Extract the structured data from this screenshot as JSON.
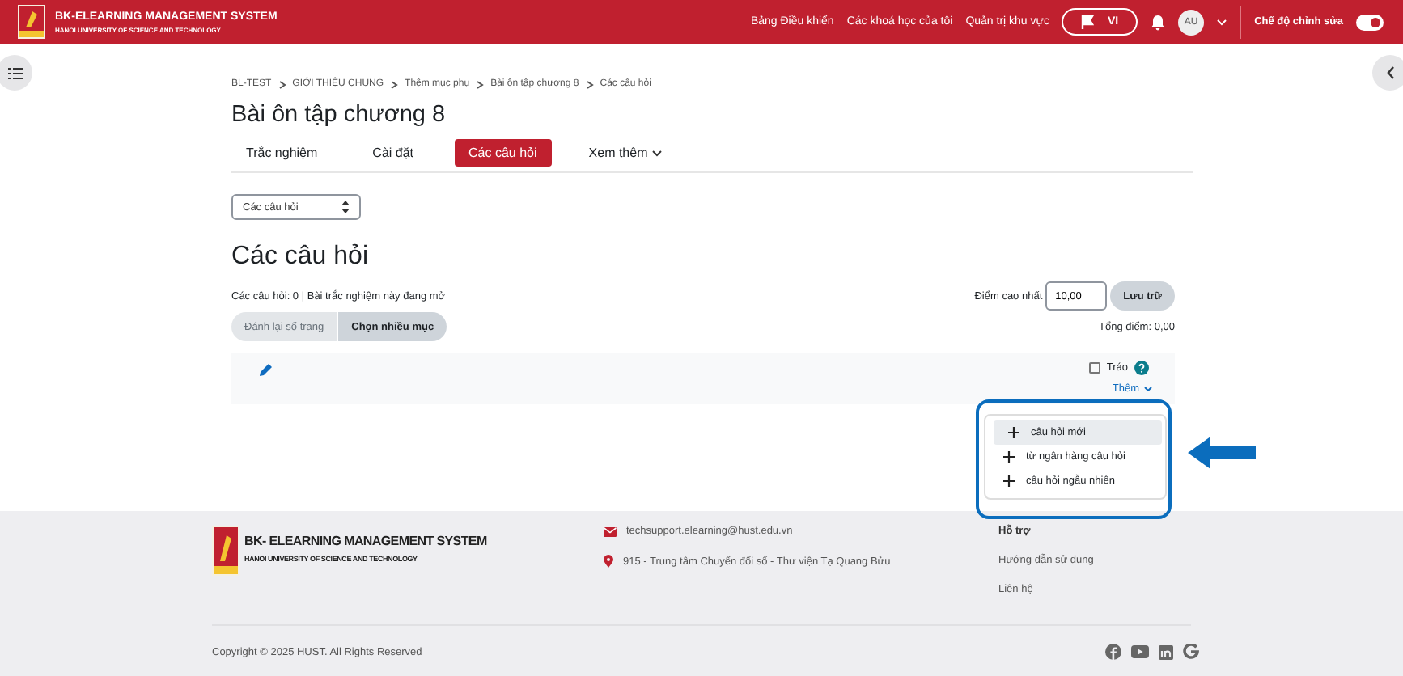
{
  "header": {
    "brand_title": "BK-ELEARNING MANAGEMENT SYSTEM",
    "brand_subtitle": "HANOI UNIVERSITY OF SCIENCE AND TECHNOLOGY",
    "nav": [
      "Bảng Điều khiển",
      "Các khoá học của tôi",
      "Quản trị khu vực"
    ],
    "language": "VI",
    "avatar": "AU",
    "edit_mode": {
      "label": "Chế độ chỉnh sửa",
      "on": true
    }
  },
  "breadcrumb": [
    "BL-TEST",
    "GIỚI THIỆU CHUNG",
    "Thêm mục phụ",
    "Bài ôn tập chương 8",
    "Các câu hỏi"
  ],
  "page_title": "Bài ôn tập chương 8",
  "tabs": [
    {
      "label": "Trắc nghiệm",
      "selected": false
    },
    {
      "label": "Cài đặt",
      "selected": false
    },
    {
      "label": "Các câu hỏi",
      "selected": true
    }
  ],
  "more_menu": "Xem thêm",
  "view_select": "Các câu hỏi",
  "heading": "Các câu hỏi",
  "summary": "Các câu hỏi: 0 | Bài trắc nghiệm này đang mở",
  "max_grade": {
    "label": "Điểm cao nhất",
    "value": "10,00",
    "button": "Lưu trữ"
  },
  "actions": [
    {
      "label": "Đánh lại số trang",
      "disabled": true
    },
    {
      "label": "Chọn nhiều mục",
      "disabled": false
    }
  ],
  "total": "Tổng điểm: 0,00",
  "shuffle": {
    "label": "Tráo",
    "checked": false
  },
  "add_menu": {
    "label": "Thêm",
    "items": [
      {
        "label": "câu hỏi mới",
        "selected": true
      },
      {
        "label": "từ ngân hàng câu hỏi",
        "selected": false
      },
      {
        "label": "câu hỏi ngẫu nhiên",
        "selected": false
      }
    ]
  },
  "footer": {
    "brand_title": "BK- ELEARNING MANAGEMENT SYSTEM",
    "brand_subtitle": "HANOI UNIVERSITY OF SCIENCE AND TECHNOLOGY",
    "email": "techsupport.elearning@hust.edu.vn",
    "address": "915 - Trung tâm Chuyển đổi số - Thư viện Tạ Quang Bửu",
    "support_title": "Hỗ trợ",
    "support_links": [
      "Hướng dẫn sử dụng",
      "Liên hệ"
    ],
    "copyright": "Copyright © 2025 HUST. All Rights Reserved"
  }
}
